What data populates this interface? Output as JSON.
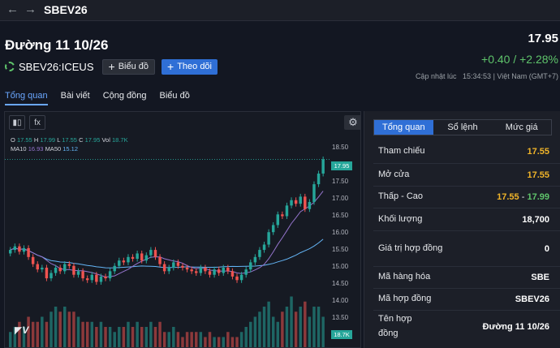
{
  "nav": {
    "back_icon": "arrow-left-icon",
    "forward_icon": "arrow-right-icon",
    "title": "SBEV26"
  },
  "header": {
    "contract_title": "Đường 11 10/26",
    "ticker": "SBEV26:ICEUS",
    "chart_button": "Biểu đồ",
    "follow_button": "Theo dõi",
    "price": "17.95",
    "change": "+0.40 / +2.28%",
    "updated_label": "Cập nhật lúc",
    "updated_time": "15:34:53",
    "timezone": "| Việt Nam (GMT+7)"
  },
  "tabs": [
    {
      "label": "Tổng quan",
      "active": true
    },
    {
      "label": "Bài viết",
      "active": false
    },
    {
      "label": "Cộng đồng",
      "active": false
    },
    {
      "label": "Biểu đồ",
      "active": false
    }
  ],
  "chart": {
    "indicator_button": "fx",
    "ohlc": {
      "o_label": "O",
      "o": "17.55",
      "h_label": "H",
      "h": "17.99",
      "l_label": "L",
      "l": "17.55",
      "c_label": "C",
      "c": "17.95",
      "vol_label": "Vol",
      "vol": "18.7K"
    },
    "ma": {
      "ma10_label": "MA10",
      "ma10": "16.93",
      "ma50_label": "MA50",
      "ma50": "15.12"
    },
    "price_badge": "17.95",
    "volume_badge": "18.7K",
    "colors": {
      "up": "#26a69a",
      "down": "#ef5350",
      "ma10": "#9575cd",
      "ma50": "#64b5f6"
    }
  },
  "chart_data": {
    "type": "candlestick",
    "y_ticks": [
      "18.50",
      "18.00",
      "17.50",
      "17.00",
      "16.50",
      "16.00",
      "15.50",
      "15.00",
      "14.50",
      "14.00",
      "13.50"
    ],
    "ylim": [
      13.3,
      18.6
    ],
    "series": [
      {
        "name": "close",
        "values": [
          15.4,
          15.5,
          15.35,
          15.45,
          15.2,
          15.0,
          14.85,
          14.9,
          14.6,
          14.75,
          14.9,
          14.8,
          15.0,
          14.95,
          14.7,
          14.8,
          14.6,
          14.55,
          14.7,
          14.5,
          14.65,
          14.6,
          14.8,
          14.95,
          15.1,
          15.05,
          15.2,
          15.15,
          15.3,
          15.1,
          15.25,
          15.4,
          15.2,
          15.0,
          14.8,
          14.9,
          15.05,
          14.95,
          14.9,
          14.85,
          14.8,
          14.75,
          14.9,
          14.8,
          14.7,
          14.85,
          14.75,
          14.9,
          14.8,
          14.65,
          14.55,
          14.7,
          14.85,
          15.05,
          15.2,
          15.4,
          15.55,
          15.9,
          16.1,
          16.4,
          16.35,
          16.65,
          16.8,
          16.7,
          16.9,
          16.55,
          16.75,
          17.25,
          17.55,
          17.95
        ]
      },
      {
        "name": "volume",
        "values": [
          3,
          4,
          5,
          4,
          6,
          5,
          5,
          6,
          5,
          7,
          8,
          7,
          8,
          7,
          7,
          6,
          5,
          5,
          5,
          4,
          5,
          4,
          4,
          3,
          4,
          4,
          5,
          4,
          5,
          4,
          4,
          5,
          4,
          5,
          3,
          3,
          4,
          3,
          2,
          3,
          3,
          3,
          3,
          2,
          3,
          2,
          2,
          2,
          3,
          2,
          2,
          3,
          4,
          5,
          6,
          7,
          8,
          9,
          6,
          5,
          7,
          8,
          10,
          7,
          8,
          9,
          6,
          8,
          8,
          6
        ]
      }
    ]
  },
  "panel": {
    "tabs": [
      {
        "label": "Tổng quan",
        "active": true
      },
      {
        "label": "Sổ lệnh",
        "active": false
      },
      {
        "label": "Mức giá",
        "active": false
      }
    ],
    "rows": [
      {
        "label": "Tham chiếu",
        "value": "17.55",
        "color": "yellow"
      },
      {
        "label": "Mở cửa",
        "value": "17.55",
        "color": "yellow"
      },
      {
        "label": "Thấp - Cao",
        "low": "17.55",
        "high": "17.99"
      },
      {
        "label": "Khối lượng",
        "value": "18,700"
      },
      {
        "label": "Giá trị hợp đồng",
        "value": "0"
      },
      {
        "label": "Mã hàng hóa",
        "value": "SBE"
      },
      {
        "label": "Mã hợp đồng",
        "value": "SBEV26"
      },
      {
        "label": "Tên hợp đồng",
        "value": "Đường 11 10/26"
      }
    ]
  }
}
